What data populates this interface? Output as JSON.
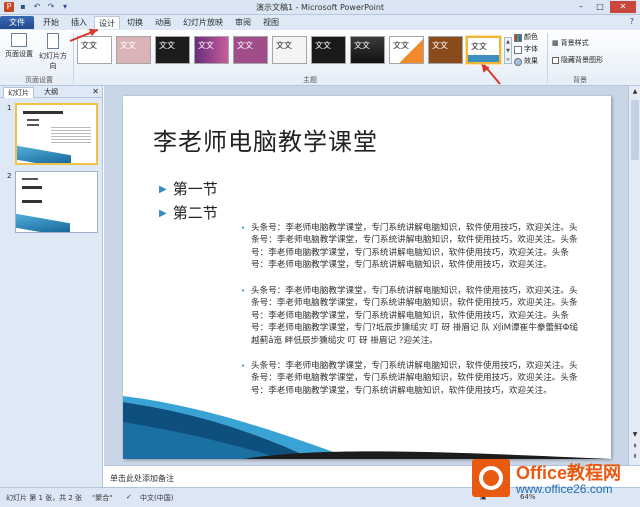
{
  "window": {
    "title": "演示文稿1 - Microsoft PowerPoint"
  },
  "tabs": [
    {
      "label": "文件"
    },
    {
      "label": "开始"
    },
    {
      "label": "插入"
    },
    {
      "label": "设计"
    },
    {
      "label": "切换"
    },
    {
      "label": "动画"
    },
    {
      "label": "幻灯片放映"
    },
    {
      "label": "审阅"
    },
    {
      "label": "视图"
    }
  ],
  "ribbon": {
    "page_setup_label": "页面设置",
    "orientation_label": "幻灯片方向",
    "group_page_setup": "页面设置",
    "group_themes": "主题",
    "group_background": "背景",
    "theme_text": "文文",
    "colors_label": "颜色",
    "fonts_label": "字体",
    "effects_label": "效果",
    "bg_styles_label": "背景样式",
    "hide_bg_label": "隐藏背景图形"
  },
  "left_pane": {
    "tab_slides": "幻灯片",
    "tab_outline": "大纲",
    "slide1_num": "1",
    "slide2_num": "2"
  },
  "slide": {
    "title": "李老师电脑教学课堂",
    "bullet1": "第一节",
    "bullet2": "第二节",
    "para1": "头条号：李老师电脑教学课堂，专门系统讲解电脑知识，软件使用技巧，欢迎关注。头条号：李老师电脑教学课堂，专门系统讲解电脑知识，软件使用技巧，欢迎关注。头条号：李老师电脑教学课堂，专门系统讲解电脑知识，软件使用技巧，欢迎关注。头条号：李老师电脑教学课堂，专门系统讲解电脑知识，软件使用技巧，欢迎关注。",
    "para2": "头条号：李老师电脑教学课堂，专门系统讲解电脑知识，软件使用技巧，欢迎关注。头条号：李老师电脑教学课堂，专门系统讲解电脑知识，软件使用技巧，欢迎关注。头条号：李老师电脑教学课堂，专门系统讲解电脑知识，软件使用技巧，欢迎关注。头条号：李老师电脑教学课堂，专门?坻辰步獯缒灾   叮    砑    褂眉记   队    刈ⅰM谭崔牛豢蕾鲜Φ缒越蓟ǎ迤     畔低辰步獯缒灾   叮    砑    褂眉记   ?迎关注。",
    "para3": "头条号：李老师电脑教学课堂，专门系统讲解电脑知识，软件使用技巧，欢迎关注。头条号：李老师电脑教学课堂，专门系统讲解电脑知识，软件使用技巧，欢迎关注。头条号：李老师电脑教学课堂，专门系统讲解电脑知识，软件使用技巧，欢迎关注。"
  },
  "notes": {
    "placeholder": "单击此处添加备注"
  },
  "status": {
    "slide_info": "幻灯片 第 1 张，共 2 张",
    "theme": "\"聚合\"",
    "language": "中文(中国)",
    "zoom": "64%"
  },
  "watermark": {
    "line1": "Office教程网",
    "line2": "www.office26.com"
  },
  "colors": {
    "accent_red": "#d8382c",
    "file_tab": "#2b5797",
    "bullet": "#2f8fc2"
  }
}
